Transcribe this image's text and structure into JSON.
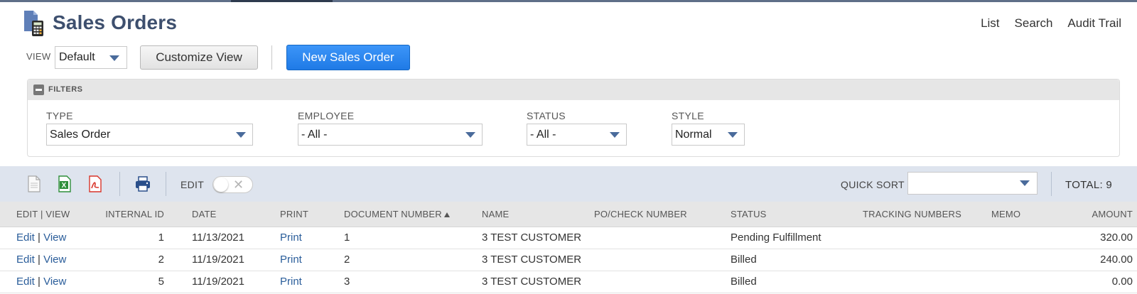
{
  "header": {
    "title": "Sales Orders",
    "links": [
      "List",
      "Search",
      "Audit Trail"
    ]
  },
  "view": {
    "label": "VIEW",
    "selected": "Default",
    "customize_label": "Customize View",
    "new_label": "New Sales Order"
  },
  "filters": {
    "title": "FILTERS",
    "type": {
      "label": "TYPE",
      "value": "Sales Order"
    },
    "employee": {
      "label": "EMPLOYEE",
      "value": "- All -"
    },
    "status": {
      "label": "STATUS",
      "value": "- All -"
    },
    "style": {
      "label": "STYLE",
      "value": "Normal"
    }
  },
  "grid_toolbar": {
    "edit_label": "EDIT",
    "edit_enabled": false,
    "quick_sort_label": "QUICK SORT",
    "quick_sort_value": "",
    "total": "TOTAL: 9",
    "icons": [
      "new-document-icon",
      "export-excel-icon",
      "export-pdf-icon",
      "print-icon"
    ]
  },
  "table": {
    "columns": [
      "EDIT | VIEW",
      "INTERNAL ID",
      "DATE",
      "PRINT",
      "DOCUMENT NUMBER",
      "NAME",
      "PO/CHECK NUMBER",
      "STATUS",
      "TRACKING NUMBERS",
      "MEMO",
      "AMOUNT"
    ],
    "sorted_column": "DOCUMENT NUMBER",
    "sort_direction": "ascending",
    "rows": [
      {
        "edit": "Edit",
        "sep": "|",
        "view": "View",
        "internal_id": "1",
        "date": "11/13/2021",
        "print": "Print",
        "doc_number": "1",
        "name": "3 TEST CUSTOMER",
        "po": "",
        "status": "Pending Fulfillment",
        "tracking": "",
        "memo": "",
        "amount": "320.00"
      },
      {
        "edit": "Edit",
        "sep": "|",
        "view": "View",
        "internal_id": "2",
        "date": "11/19/2021",
        "print": "Print",
        "doc_number": "2",
        "name": "3 TEST CUSTOMER",
        "po": "",
        "status": "Billed",
        "tracking": "",
        "memo": "",
        "amount": "240.00"
      },
      {
        "edit": "Edit",
        "sep": "|",
        "view": "View",
        "internal_id": "5",
        "date": "11/19/2021",
        "print": "Print",
        "doc_number": "3",
        "name": "3 TEST CUSTOMER",
        "po": "",
        "status": "Billed",
        "tracking": "",
        "memo": "",
        "amount": "0.00"
      }
    ]
  },
  "colors": {
    "title": "#3d4f6e",
    "primary_button": "#1f7ae6",
    "link": "#2a5d9a",
    "toolbar_bg": "#dee4ee",
    "header_bg": "#e6e6e6"
  }
}
